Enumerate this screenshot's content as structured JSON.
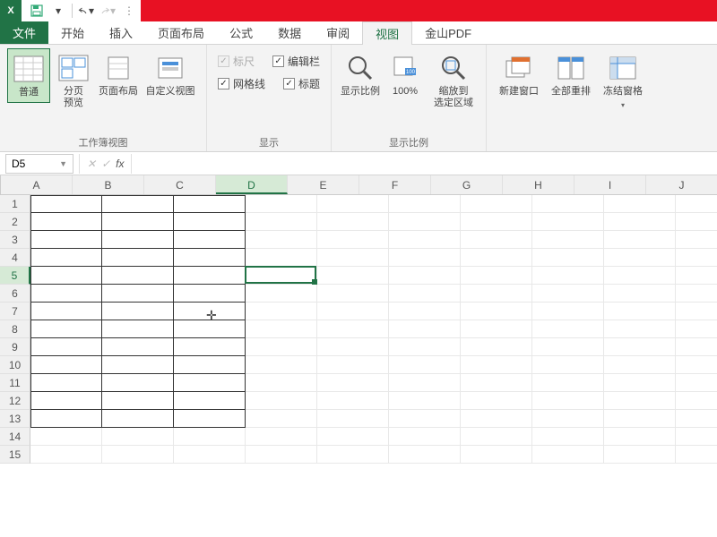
{
  "qat": {
    "save": "save",
    "undo": "undo",
    "redo": "redo"
  },
  "tabs": {
    "file": "文件",
    "items": [
      "开始",
      "插入",
      "页面布局",
      "公式",
      "数据",
      "审阅",
      "视图",
      "金山PDF"
    ],
    "active_index": 6
  },
  "ribbon": {
    "group_views": {
      "label": "工作簿视图",
      "normal": "普通",
      "page_break": "分页\n预览",
      "page_layout": "页面布局",
      "custom": "自定义视图"
    },
    "group_show": {
      "label": "显示",
      "ruler": "标尺",
      "formula_bar": "编辑栏",
      "gridlines": "网格线",
      "headings": "标题"
    },
    "group_zoom": {
      "label": "显示比例",
      "zoom": "显示比例",
      "hundred": "100%",
      "to_selection": "缩放到\n选定区域"
    },
    "group_window": {
      "new_window": "新建窗口",
      "arrange": "全部重排",
      "freeze": "冻结窗格"
    }
  },
  "namebox": "D5",
  "fx_label": "fx",
  "columns": [
    "A",
    "B",
    "C",
    "D",
    "E",
    "F",
    "G",
    "H",
    "I",
    "J"
  ],
  "rows": [
    1,
    2,
    3,
    4,
    5,
    6,
    7,
    8,
    9,
    10,
    11,
    12,
    13,
    14,
    15
  ],
  "active": {
    "col_index": 3,
    "row_index": 4
  },
  "bordered_range": {
    "cols": 3,
    "rows": 13
  }
}
